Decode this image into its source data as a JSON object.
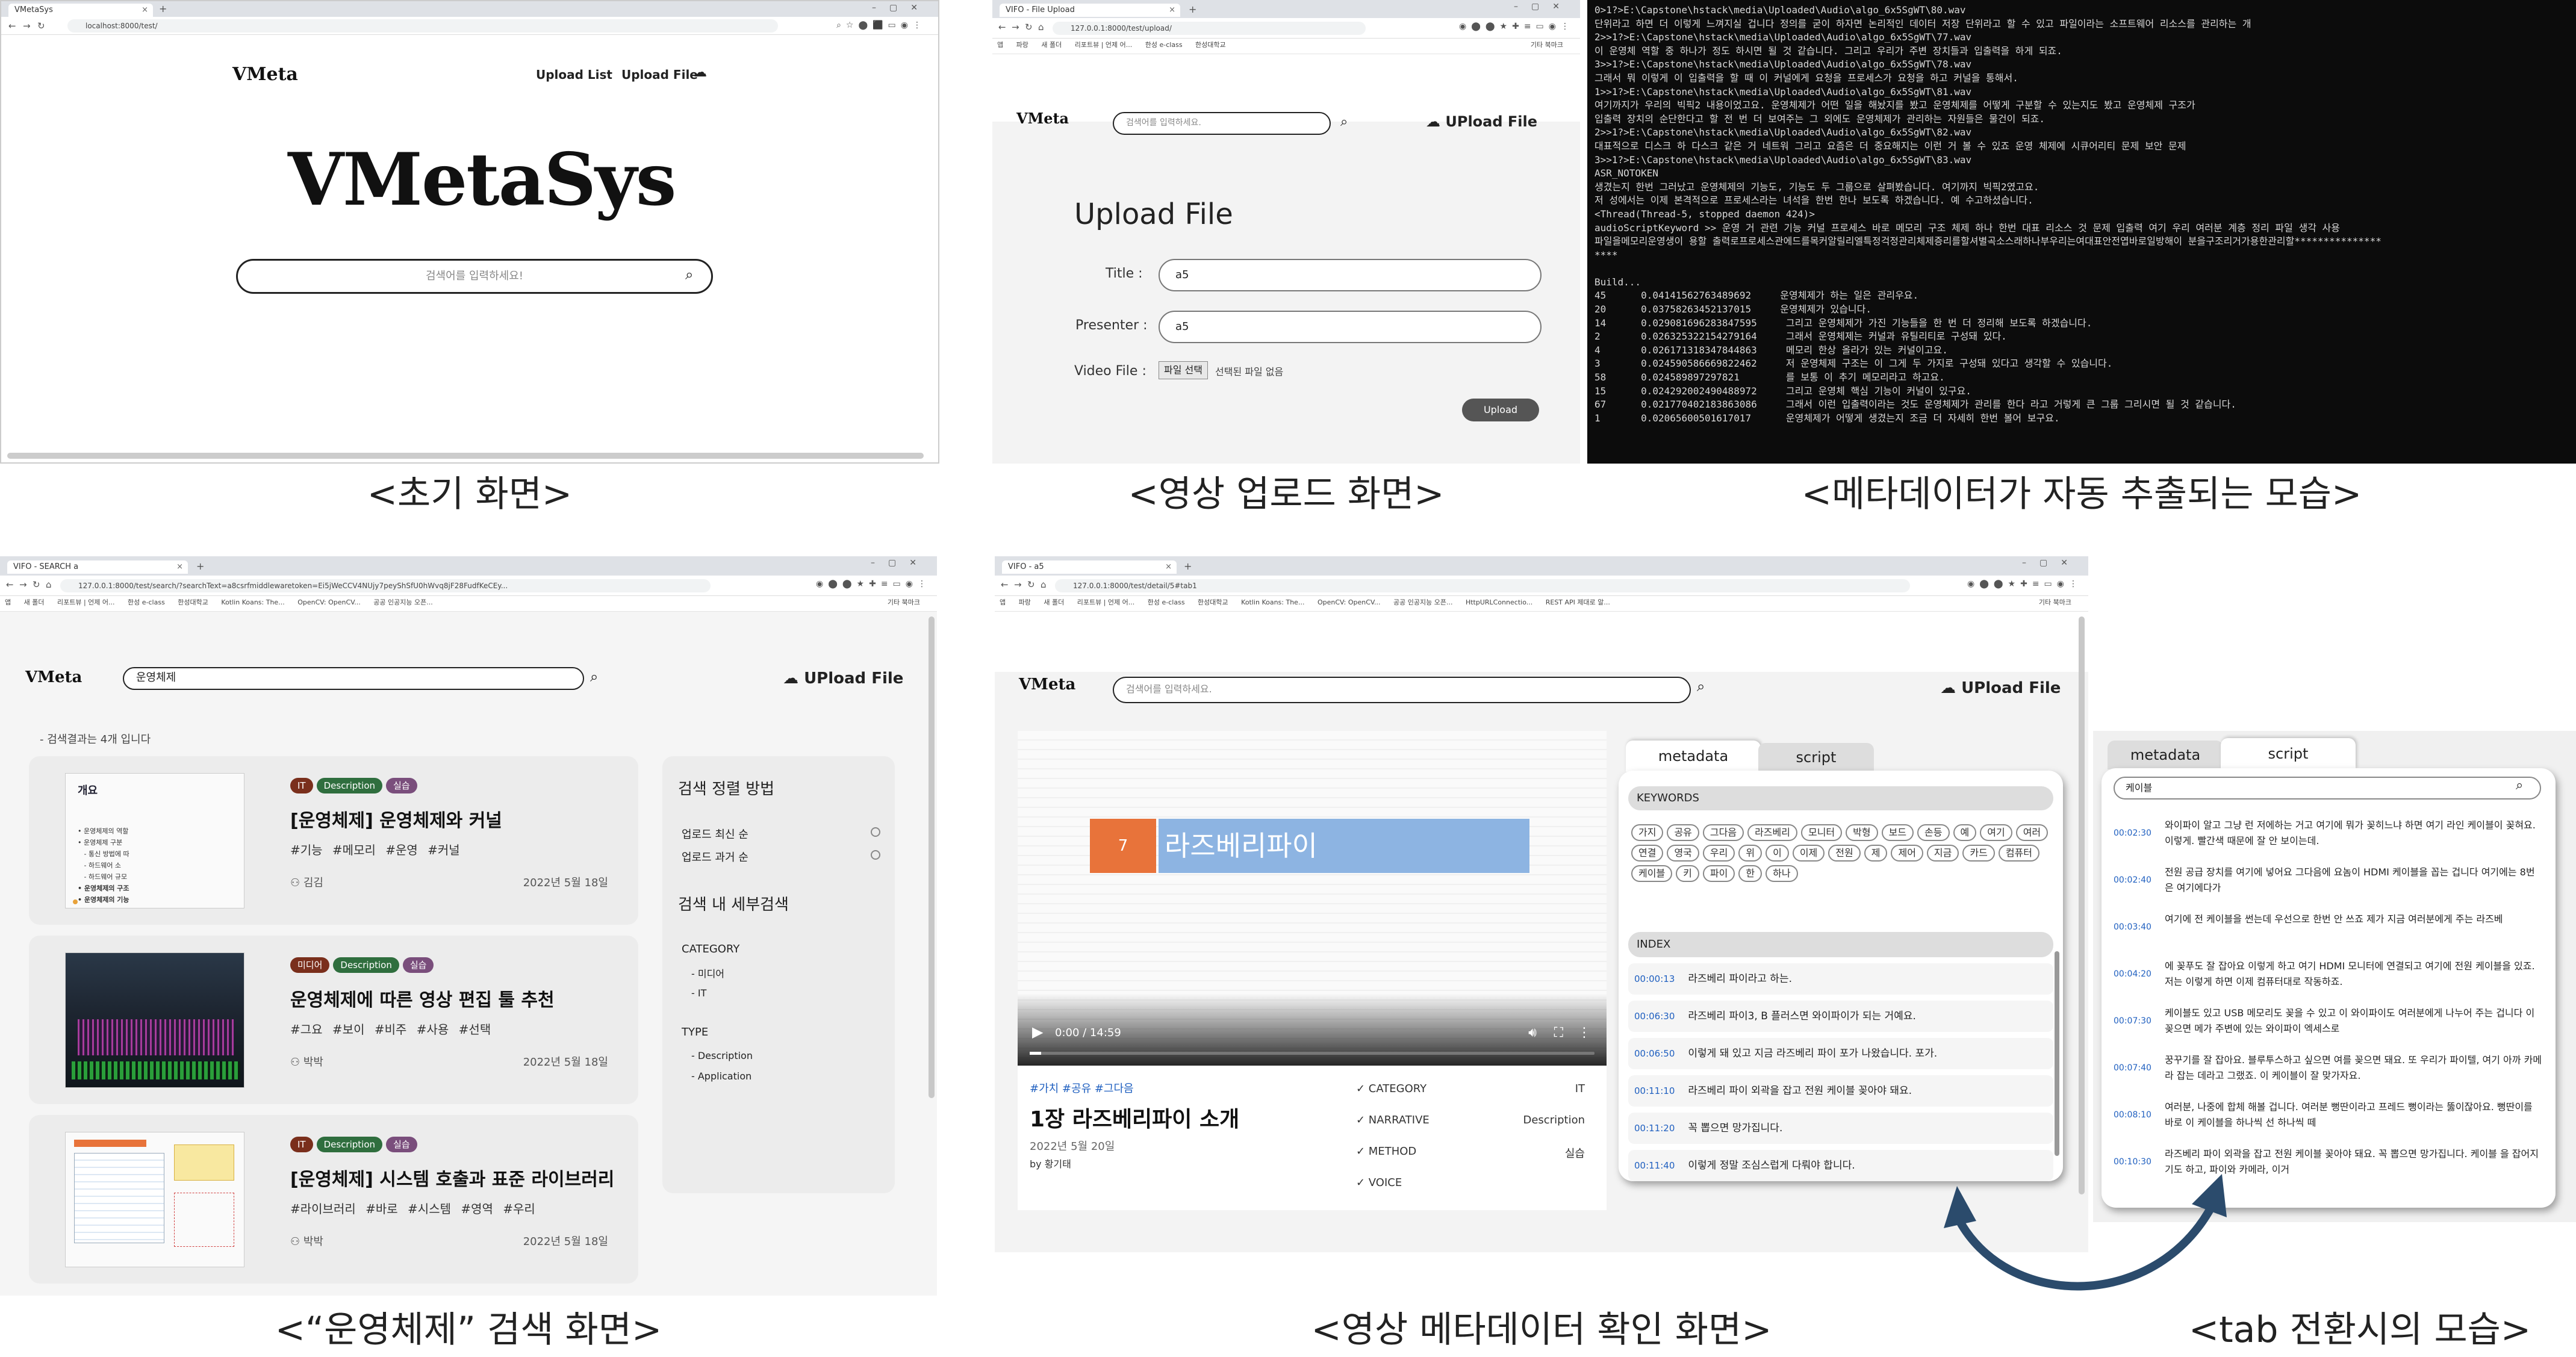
{
  "captions": {
    "initial": "<초기 화면>",
    "upload": "<영상 업로드 화면>",
    "meta_extract": "<메타데이터가 자동 추출되는 모습>",
    "search": "<“운영체제” 검색 화면>",
    "detail": "<영상 메타데이터 확인 화면>",
    "tab_switch": "<tab 전환시의 모습>"
  },
  "initial": {
    "tab_title": "VMetaSys",
    "url": "localhost:8000/test/",
    "logo_small": "VMeta",
    "nav_upload_list": "Upload List",
    "nav_upload_file": "Upload File",
    "logo_big": "VMetaSys",
    "search_placeholder": "검색어를 입력하세요!"
  },
  "upload": {
    "tab_title": "VIFO - File Upload",
    "url": "127.0.0.1:8000/test/upload/",
    "bookmarks": [
      "앱",
      "파랑",
      "새 폴더",
      "리포트뷰 | 언제 어...",
      "한성 e-class",
      "한성대학교",
      "기타 북마크"
    ],
    "logo": "VMeta",
    "search_placeholder": "검색어를 입력하세요.",
    "upload_nav": "UPload File",
    "heading": "Upload File",
    "title_label": "Title :",
    "title_value": "a5",
    "presenter_label": "Presenter :",
    "presenter_value": "a5",
    "video_label": "Video File :",
    "file_button": "파일 선택",
    "file_status": "선택된 파일 없음",
    "submit": "Upload"
  },
  "terminal": {
    "lines": [
      "0>1?>E:\\Capstone\\hstack\\media\\Uploaded\\Audio\\algo_6x5SgWT\\80.wav",
      "단위라고 하면 더 이렇게 느껴지실 겁니다 정의를 굳이 하자면 논리적인 데이터 저장 단위라고 할 수 있고 파일이라는 소프트웨어 리소스를 관리하는 개",
      "2>>1?>E:\\Capstone\\hstack\\media\\Uploaded\\Audio\\algo_6x5SgWT\\77.wav",
      "이 운영체 역할 중 하나가 정도 하시면 될 것 같습니다. 그리고 우리가 주변 장치들과 입출력을 하게 되죠.",
      "3>>1?>E:\\Capstone\\hstack\\media\\Uploaded\\Audio\\algo_6x5SgWT\\78.wav",
      "그래서 뭐 이렇게 이 입출력을 할 때 이 커널에게 요청을 프로세스가 요청을 하고 커널을 통해서.",
      "1>>1?>E:\\Capstone\\hstack\\media\\Uploaded\\Audio\\algo_6x5SgWT\\81.wav",
      "여기까지가 우리의 빅픽2 내용이었고요. 운영체제가 어떤 일을 해놨지를 봤고 운영체제를 어떻게 구분할 수 있는지도 봤고 운영체제 구조가",
      "입출력 장치의 순단한다고 할 전 번 더 보여주는 그 외에도 운영체제가 관리하는 자원들은 물건이 되죠.",
      "2>>1?>E:\\Capstone\\hstack\\media\\Uploaded\\Audio\\algo_6x5SgWT\\82.wav",
      "대표적으로 디스크 하 다스크 같은 거 네트워 그리고 요즘은 더 중요해지는 이런 거 볼 수 있죠 운영 체제에 시큐어리티 문제 보안 문제",
      "3>>1?>E:\\Capstone\\hstack\\media\\Uploaded\\Audio\\algo_6x5SgWT\\83.wav",
      "ASR_NOTOKEN",
      "생겼는지 한번 그러났고 운영체제의 기능도, 기능도 두 그룹으로 살펴봤습니다. 여기까지 빅픽2였고요.",
      "저 성에서는 이제 본격적으로 프로세스라는 녀석을 한번 한나 보도록 하겠습니다. 예 수고하셨습니다.",
      "<Thread(Thread-5, stopped daemon 424)>",
      "audioScriptKeyword >> 운영 거 관련 기능 커널 프로세스 바로 메모리 구조 체제 하나 한번 대표 리소스 것 문제 입출력 여기 우리 여러분 계층 정리 파일 생각 사용",
      "파일을메모리운영생이 용할 출력로프로세스관에드를목커알릴리엘특정걱정관리체제증리를할셔별곡소스래하나부우리는여대표안전엽바로일방해이 분을구조리거가용한관리할***************",
      "****",
      "",
      "Build...",
      "45      0.04141562763489692     운영체제가 하는 일은 관리우요.",
      "20      0.03758263452137015     운영체제가 있습니다.",
      "14      0.029081696283847595     그리고 운영체제가 가진 기능들을 한 번 더 정리해 보도록 하겠습니다.",
      "2       0.026325322154279164     그래서 운영체제는 커널과 유틸리티로 구성돼 있다.",
      "4       0.026171318347844863     메모리 한상 올라가 있는 커널이고요.",
      "3       0.024590586669822462     저 운영체제 구조는 이 그게 두 가지로 구성돼 있다고 생각할 수 있습니다.",
      "58      0.024589897297821        를 보통 이 추기 메모리라고 하고요.",
      "15      0.024292002490488972     그리고 운영체 핵심 기능이 커널이 있구요.",
      "67      0.021770402183863086     그래서 이런 입출력이라는 것도 운영체제가 관리를 한다 라고 거렇게 큰 그룹 그리시면 될 것 같습니다.",
      "1       0.02065600501617017      운영체제가 어떻게 생겼는지 조금 더 자세히 한번 볼어 보구요."
    ]
  },
  "search": {
    "tab_title": "VIFO - SEARCH a",
    "url": "127.0.0.1:8000/test/search/?searchText=a8csrfmiddlewaretoken=Ei5jWeCCV4NUjy7peyShSfU0hWvq8jF28FudfKeCEy...",
    "bookmarks": [
      "앱",
      "새 폴더",
      "리포트뷰 | 언제 어...",
      "한성 e-class",
      "한성대학교",
      "Kotlin Koans: The...",
      "OpenCV: OpenCV...",
      "공공 인공지능 오픈...",
      "기타 북마크"
    ],
    "logo": "VMeta",
    "search_value": "운영체제",
    "upload_nav": "UPload File",
    "result_count": "- 검색결과는 4개 입니다",
    "results": [
      {
        "tags": [
          "IT",
          "Description",
          "실습"
        ],
        "title": "[운영체제] 운영체제와 커널",
        "hashtags": "#기능 #메모리 #운영 #커널",
        "author": "김김",
        "date": "2022년 5월 18일",
        "thumb_title": "개요"
      },
      {
        "tags": [
          "미디어",
          "Description",
          "실습"
        ],
        "title": "운영체제에 따른 영상 편집 툴 추천",
        "hashtags": "#그요 #보이 #비주 #사용 #선택",
        "author": "박박",
        "date": "2022년 5월 18일"
      },
      {
        "tags": [
          "IT",
          "Description",
          "실습"
        ],
        "title": "[운영체제] 시스템 호출과 표준 라이브러리",
        "hashtags": "#라이브러리 #바로 #시스템 #영역 #우리",
        "author": "박박",
        "date": "2022년 5월 18일"
      }
    ],
    "thumb_lines": [
      "• 운영체제의 역할",
      "• 운영체제 구분",
      "   - 통신 방법에 따",
      "   - 하드웨어 소",
      "   - 하드웨어 규모",
      "• 운영체제의 구조",
      "• 운영체제의 기능"
    ],
    "sidebar": {
      "sort_heading": "검색 정렬 방법",
      "sort_options": [
        "업로드 최신 순",
        "업로드 과거 순"
      ],
      "detail_heading": "검색 내 세부검색",
      "category_label": "CATEGORY",
      "categories": [
        "- 미디어",
        "- IT"
      ],
      "type_label": "TYPE",
      "types": [
        "- Description",
        "- Application"
      ]
    }
  },
  "detail": {
    "tab_title": "VIFO - a5",
    "url": "127.0.0.1:8000/test/detail/5#tab1",
    "bookmarks": [
      "앱",
      "파랑",
      "새 폴더",
      "리포트뷰 | 언제 어...",
      "한성 e-class",
      "한성대학교",
      "Kotlin Koans: The...",
      "OpenCV: OpenCV...",
      "공공 인공지능 오픈...",
      "HttpURLConnectio...",
      "REST API 제대로 알...",
      "기타 북마크"
    ],
    "logo": "VMeta",
    "search_placeholder": "검색어를 입력하세요.",
    "upload_nav": "UPload File",
    "slide_number": "7",
    "slide_title": "라즈베리파이",
    "video_time": "0:00 / 14:59",
    "hashtags": "#가치 #공유 #그다음",
    "title": "1장 라즈베리파이 소개",
    "date": "2022년 5월 20일",
    "by": "by 황기태",
    "meta_rows": [
      {
        "label": "✓ CATEGORY",
        "value": "IT"
      },
      {
        "label": "✓ NARRATIVE",
        "value": "Description"
      },
      {
        "label": "✓ METHOD",
        "value": "실습"
      },
      {
        "label": "✓ VOICE",
        "value": ""
      }
    ],
    "tab_metadata": "metadata",
    "tab_script": "script",
    "keywords_label": "KEYWORDS",
    "keywords": [
      "가지",
      "공유",
      "그다음",
      "라즈베리",
      "모니터",
      "박형",
      "보드",
      "손등",
      "예",
      "여기",
      "여러",
      "연결",
      "영국",
      "우리",
      "위",
      "이",
      "이제",
      "전원",
      "제",
      "제어",
      "지금",
      "카드",
      "컴퓨터",
      "케이블",
      "키",
      "파이",
      "한",
      "하나"
    ],
    "index_label": "INDEX",
    "index": [
      {
        "time": "00:00:13",
        "text": "라즈베리 파이라고 하는."
      },
      {
        "time": "00:06:30",
        "text": "라즈베리 파이3, B 플러스면 와이파이가 되는 거예요."
      },
      {
        "time": "00:06:50",
        "text": "이렇게 돼 있고 지금 라즈베리 파이 포가 나왔습니다. 포가."
      },
      {
        "time": "00:11:10",
        "text": "라즈베리 파이 외곽을 잡고 전원 케이블 꽂아야 돼요."
      },
      {
        "time": "00:11:20",
        "text": "꼭 뽑으면 망가집니다."
      },
      {
        "time": "00:11:40",
        "text": "이렇게 정말 조심스럽게 다뤄야 합니다."
      }
    ]
  },
  "tabview": {
    "tab_metadata": "metadata",
    "tab_script": "script",
    "search_value": "케이블",
    "scripts": [
      {
        "time": "00:02:30",
        "text": "와이파이 알고 그냥 런 저에하는 거고 여기에 뭐가 꽂히느냐 하면 여기 라인 케이블이 꽂혀요. 이렇게. 빨간색 때문에 잘 안 보이는데."
      },
      {
        "time": "00:02:40",
        "text": "전원 공급 장치를 여기에 넣어요 그다음에 요놈이 HDMI 케이블을 꼽는 겁니다 여기에는 8번은 여기에다가"
      },
      {
        "time": "00:03:40",
        "text": "여기에 전 케이블을 썬는데 우선으로 한번 안 쓰죠 제가 지금 여러분에게 주는 라즈베"
      },
      {
        "time": "00:04:20",
        "text": "에 꽂푸도 잘 잡아요 이렇게 하고 여기 HDMI 모니터에 연결되고 여기에 전원 케이블을 있죠. 저는 이렇게 하면 이제 컴퓨터대로 작동하죠."
      },
      {
        "time": "00:07:30",
        "text": "케이블도 있고 USB 메모리도 꽂을 수 있고 이 와이파이도 여러분에게 나누어 주는 겁니다 이 꽂으면 메가 주변에 있는 와이파이 엑세스로"
      },
      {
        "time": "00:07:40",
        "text": "꿍꾸기를 잘 잡아요. 블루투스하고 싶으면 여를 꽂으면 돼요. 또 우리가 파이텔, 여기 아까 카메라 잡는 데라고 그랬죠. 이 케이블이 잘 맞가자요."
      },
      {
        "time": "00:08:10",
        "text": "여러분, 나중에 합체 해볼 겁니다. 여러분 뻥딴이라고 프레드 뻥이라는 뚫이잖아요. 뻥딴이를 바로 이 케이블을 하나씩 선 하나씩 떼"
      },
      {
        "time": "00:10:30",
        "text": "라즈베리 파이 외곽을 잡고 전원 케이블 꽂아야 돼요. 꼭 뽑으면 망가집니다. 케이블 을 잡어지기도 하고, 파이와 카메라, 이거"
      }
    ]
  },
  "colors": {
    "accent_orange": "#e8733a",
    "slide_blue": "#8db4e2",
    "tag_it": "#7a2f1c",
    "tag_desc": "#2f6e3e",
    "tag_prac": "#7a4e7c",
    "arrow": "#2b4b6c"
  }
}
